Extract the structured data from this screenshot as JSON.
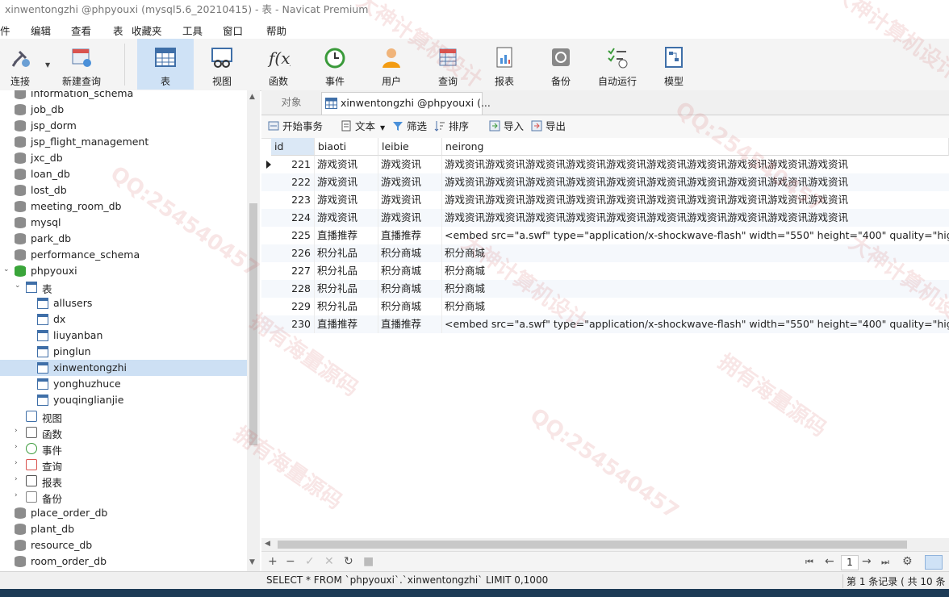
{
  "window_title": "xinwentongzhi @phpyouxi (mysql5.6_20210415) - 表 - Navicat Premium",
  "menu": [
    "件",
    "编辑",
    "查看",
    "表",
    "收藏夹",
    "工具",
    "窗口",
    "帮助"
  ],
  "toolbar": {
    "connect": "连接",
    "new_query": "新建查询",
    "table": "表",
    "view": "视图",
    "function": "函数",
    "event": "事件",
    "user": "用户",
    "query": "查询",
    "report": "报表",
    "backup": "备份",
    "autorun": "自动运行",
    "model": "模型"
  },
  "sidebar": {
    "top_dbs": [
      "information_schema",
      "job_db",
      "jsp_dorm",
      "jsp_flight_management",
      "jxc_db",
      "loan_db",
      "lost_db",
      "meeting_room_db",
      "mysql",
      "park_db",
      "performance_schema"
    ],
    "open_db": "phpyouxi",
    "tables_group": "表",
    "tables": [
      "allusers",
      "dx",
      "liuyanban",
      "pinglun",
      "xinwentongzhi",
      "yonghuzhuce",
      "youqinglianjie"
    ],
    "groups": [
      "视图",
      "函数",
      "事件",
      "查询",
      "报表",
      "备份"
    ],
    "bottom_dbs": [
      "place_order_db",
      "plant_db",
      "resource_db",
      "room_order_db"
    ]
  },
  "tabs": {
    "objects": "对象",
    "active": "xinwentongzhi @phpyouxi (..."
  },
  "obj_toolbar": {
    "begin_tx": "开始事务",
    "text": "文本",
    "filter": "筛选",
    "sort": "排序",
    "import": "导入",
    "export": "导出"
  },
  "grid": {
    "columns": [
      "id",
      "biaoti",
      "leibie",
      "neirong"
    ],
    "rows": [
      [
        "221",
        "游戏资讯",
        "游戏资讯",
        "游戏资讯游戏资讯游戏资讯游戏资讯游戏资讯游戏资讯游戏资讯游戏资讯游戏资讯游戏资讯"
      ],
      [
        "222",
        "游戏资讯",
        "游戏资讯",
        "游戏资讯游戏资讯游戏资讯游戏资讯游戏资讯游戏资讯游戏资讯游戏资讯游戏资讯游戏资讯"
      ],
      [
        "223",
        "游戏资讯",
        "游戏资讯",
        "游戏资讯游戏资讯游戏资讯游戏资讯游戏资讯游戏资讯游戏资讯游戏资讯游戏资讯游戏资讯"
      ],
      [
        "224",
        "游戏资讯",
        "游戏资讯",
        "游戏资讯游戏资讯游戏资讯游戏资讯游戏资讯游戏资讯游戏资讯游戏资讯游戏资讯游戏资讯"
      ],
      [
        "225",
        "直播推荐",
        "直播推荐",
        "<embed src=\"a.swf\" type=\"application/x-shockwave-flash\" width=\"550\" height=\"400\" quality=\"high\" />sadf"
      ],
      [
        "226",
        "积分礼品",
        "积分商城",
        "积分商城"
      ],
      [
        "227",
        "积分礼品",
        "积分商城",
        "积分商城"
      ],
      [
        "228",
        "积分礼品",
        "积分商城",
        "积分商城"
      ],
      [
        "229",
        "积分礼品",
        "积分商城",
        "积分商城"
      ],
      [
        "230",
        "直播推荐",
        "直播推荐",
        "<embed src=\"a.swf\" type=\"application/x-shockwave-flash\" width=\"550\" height=\"400\" quality=\"high\" />sadf"
      ]
    ]
  },
  "pager": {
    "page": "1"
  },
  "status": {
    "sql": "SELECT * FROM `phpyouxi`.`xinwentongzhi` LIMIT 0,1000",
    "record": "第 1 条记录 ( 共 10 条"
  },
  "watermarks": [
    "大神计算机设计",
    "QQ:254540457",
    "拥有海量源码"
  ]
}
